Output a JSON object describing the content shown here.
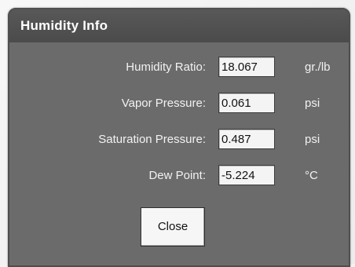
{
  "window": {
    "title": "Humidity Info"
  },
  "fields": [
    {
      "label": "Humidity Ratio:",
      "value": "18.067",
      "unit": "gr./lb"
    },
    {
      "label": "Vapor Pressure:",
      "value": "0.061",
      "unit": "psi"
    },
    {
      "label": "Saturation Pressure:",
      "value": "0.487",
      "unit": "psi"
    },
    {
      "label": "Dew Point:",
      "value": "-5.224",
      "unit": "°C"
    }
  ],
  "buttons": {
    "close_label": "Close"
  },
  "colors": {
    "dialog_background": "#6b6b6b",
    "titlebar": "#4b4b4b",
    "label_text": "#f2f2f2",
    "field_background": "#f4f4f4"
  }
}
